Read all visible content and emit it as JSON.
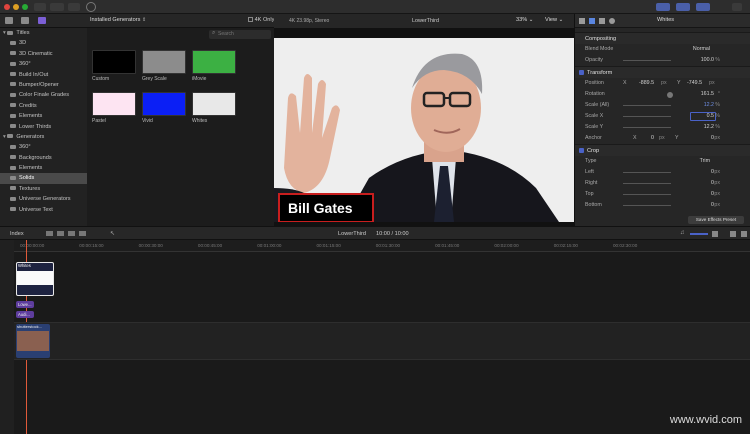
{
  "browser": {
    "dropdown_label": "Installed Generators",
    "filter_4k_label": "4K Only",
    "search_placeholder": "Search",
    "sidebar": [
      {
        "label": "Titles",
        "level": 0
      },
      {
        "label": "3D",
        "level": 1
      },
      {
        "label": "3D Cinematic",
        "level": 1
      },
      {
        "label": "360°",
        "level": 1
      },
      {
        "label": "Build In/Out",
        "level": 1
      },
      {
        "label": "Bumper/Opener",
        "level": 1
      },
      {
        "label": "Color Finale Grades",
        "level": 1
      },
      {
        "label": "Credits",
        "level": 1
      },
      {
        "label": "Elements",
        "level": 1
      },
      {
        "label": "Lower Thirds",
        "level": 1
      },
      {
        "label": "Generators",
        "level": 0
      },
      {
        "label": "360°",
        "level": 1
      },
      {
        "label": "Backgrounds",
        "level": 1
      },
      {
        "label": "Elements",
        "level": 1
      },
      {
        "label": "Solids",
        "level": 1,
        "selected": true
      },
      {
        "label": "Textures",
        "level": 1
      },
      {
        "label": "Universe Generators",
        "level": 1
      },
      {
        "label": "Universe Text",
        "level": 1
      }
    ],
    "thumbnails": [
      {
        "label": "Custom",
        "color": "#000000"
      },
      {
        "label": "Grey Scale",
        "color": "#8c8c8c"
      },
      {
        "label": "iMovie",
        "color": "#3cb043"
      },
      {
        "label": "Pastel",
        "color": "#fde4f2"
      },
      {
        "label": "Vivid",
        "color": "#0b1ff5"
      },
      {
        "label": "Whites",
        "color": "#e8e8e8"
      }
    ]
  },
  "viewer": {
    "format": "4K 23.98p, Stereo",
    "clip_name": "LowerThird",
    "zoom": "33%",
    "view_label": "View",
    "lower_third_text": "Bill Gates"
  },
  "inspector": {
    "title": "Whites",
    "compositing": {
      "header": "Compositing",
      "blend_mode_label": "Blend Mode",
      "blend_mode_value": "Normal",
      "opacity_label": "Opacity",
      "opacity_value": "100.0",
      "opacity_unit": "%"
    },
    "transform": {
      "header": "Transform",
      "position_label": "Position",
      "position_x_label": "X",
      "position_x": "-889.5",
      "position_x_unit": "px",
      "position_y_label": "Y",
      "position_y": "-749.5",
      "position_y_unit": "px",
      "rotation_label": "Rotation",
      "rotation_value": "161.5",
      "rotation_unit": "°",
      "scale_all_label": "Scale (All)",
      "scale_all_value": "12.2",
      "scale_x_label": "Scale X",
      "scale_x_value": "0.5",
      "scale_y_label": "Scale Y",
      "scale_y_value": "12.2",
      "percent_unit": "%",
      "anchor_label": "Anchor",
      "anchor_x_label": "X",
      "anchor_x": "0",
      "anchor_y_label": "Y",
      "anchor_y": "0",
      "px_unit": "px"
    },
    "crop": {
      "header": "Crop",
      "type_label": "Type",
      "type_value": "Trim",
      "left_label": "Left",
      "left_value": "0",
      "right_label": "Right",
      "right_value": "0",
      "top_label": "Top",
      "top_value": "0",
      "bottom_label": "Bottom",
      "bottom_value": "0",
      "unit": "px"
    },
    "save_preset_label": "Save Effects Preset"
  },
  "timeline": {
    "index_label": "Index",
    "project_name": "LowerThird",
    "timecode": "10:00 / 10:00",
    "ruler_labels": [
      "00:00:00:00",
      "00:00:15:00",
      "00:00:30:00",
      "00:00:45:00",
      "00:01:00:00",
      "00:01:15:00",
      "00:01:30:00",
      "00:01:45:00",
      "00:02:00:00",
      "00:02:15:00",
      "00:02:30:00"
    ],
    "clips": {
      "whites_label": "Whites",
      "lower1_label": "Lowe...",
      "lower2_label": "Audi...",
      "video_label": "shutterstock..."
    }
  },
  "watermark": "www.wvid.com"
}
